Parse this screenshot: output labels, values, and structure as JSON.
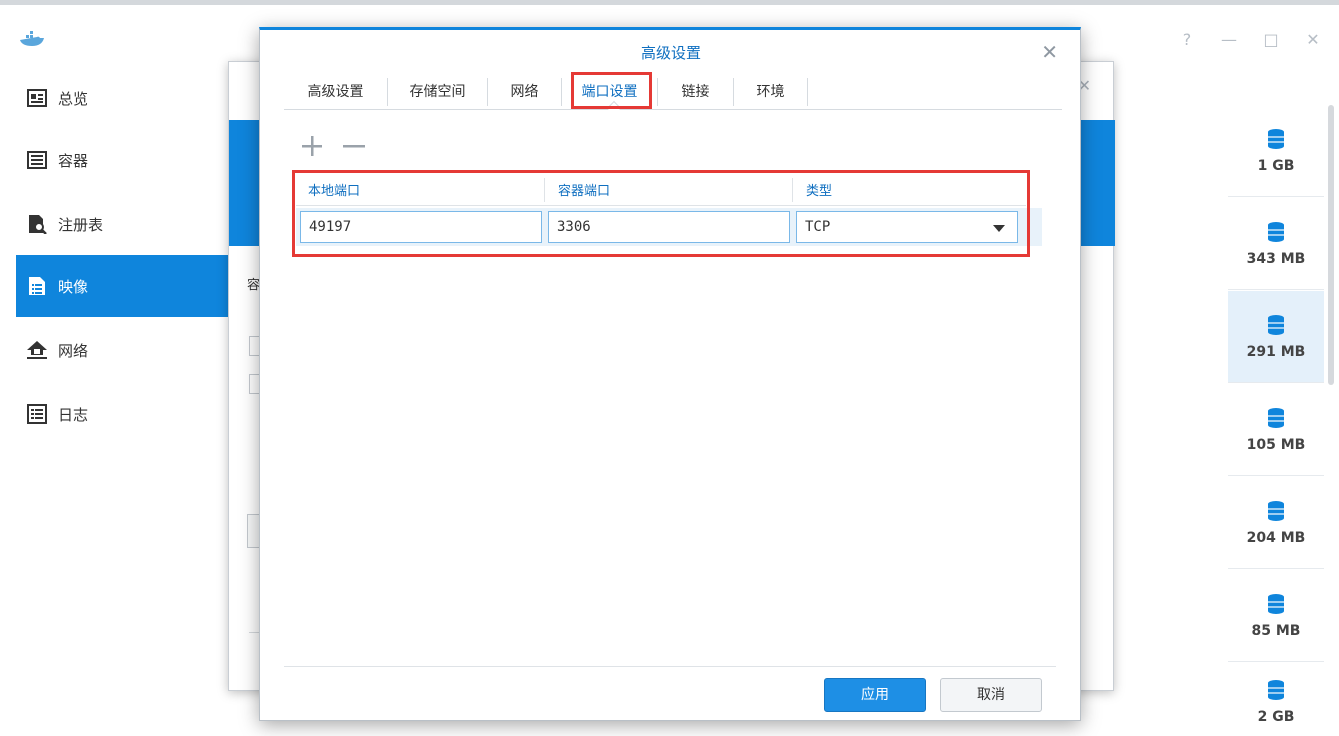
{
  "window": {
    "controls": [
      "?",
      "—",
      "□",
      "✕"
    ]
  },
  "sidebar": {
    "items": [
      {
        "label": "总览",
        "icon": "overview-icon"
      },
      {
        "label": "容器",
        "icon": "container-icon"
      },
      {
        "label": "注册表",
        "icon": "registry-search-icon"
      },
      {
        "label": "映像",
        "icon": "image-icon"
      },
      {
        "label": "网络",
        "icon": "network-icon"
      },
      {
        "label": "日志",
        "icon": "log-icon"
      }
    ],
    "active": "映像"
  },
  "image_sizes": [
    "1 GB",
    "343 MB",
    "291 MB",
    "105 MB",
    "204 MB",
    "85 MB",
    "2 GB"
  ],
  "background_dialog": {
    "label_fragment": "容"
  },
  "dialog": {
    "title": "高级设置",
    "tabs": [
      "高级设置",
      "存储空间",
      "网络",
      "端口设置",
      "链接",
      "环境"
    ],
    "active_tab": "端口设置",
    "toolbar": {
      "add": "+",
      "remove": "—"
    },
    "port_table": {
      "headers": [
        "本地端口",
        "容器端口",
        "类型"
      ],
      "row": {
        "local_port": "49197",
        "container_port": "3306",
        "type": "TCP"
      }
    },
    "buttons": {
      "apply": "应用",
      "cancel": "取消"
    }
  },
  "colors": {
    "accent": "#0f85dc",
    "highlight_box": "#e53935",
    "link_text": "#0f6fc0"
  }
}
